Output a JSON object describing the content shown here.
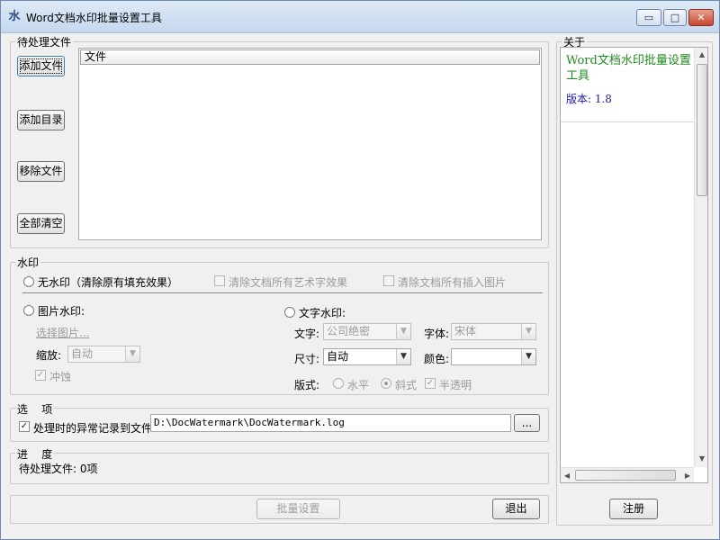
{
  "window": {
    "title": "Word文档水印批量设置工具",
    "controls": {
      "minimize": "▭",
      "maximize": "□",
      "close": "✕"
    }
  },
  "files": {
    "group_title": "待处理文件",
    "buttons": {
      "add_file": "添加文件",
      "add_dir": "添加目录",
      "remove_file": "移除文件",
      "clear_all": "全部清空"
    },
    "list": {
      "column_header": "文件",
      "items": []
    }
  },
  "watermark": {
    "group_title": "水印",
    "no_watermark_label": "无水印（清除原有填充效果）",
    "clear_wordart_label": "清除文档所有艺术字效果",
    "clear_images_label": "清除文档所有插入图片",
    "image": {
      "label": "图片水印:",
      "choose_link": "选择图片...",
      "scale_label": "缩放:",
      "scale_value": "自动",
      "washout_label": "冲蚀",
      "washout_checked": true
    },
    "text": {
      "label": "文字水印:",
      "text_label": "文字:",
      "text_value": "公司绝密",
      "font_label": "字体:",
      "font_value": "宋体",
      "size_label": "尺寸:",
      "size_value": "自动",
      "color_label": "颜色:",
      "color_value": "",
      "layout_label": "版式:",
      "horizontal_label": "水平",
      "diagonal_label": "斜式",
      "semitransparent_label": "半透明",
      "layout_selected": "diagonal",
      "semitransparent_checked": true
    }
  },
  "options": {
    "group_title": "选    项",
    "log_label": "处理时的异常记录到文件:",
    "log_checked": true,
    "log_path": "D:\\DocWatermark\\DocWatermark.log",
    "browse_label": "..."
  },
  "progress": {
    "group_title": "进    度",
    "pending_text": "待处理文件: 0项"
  },
  "bottom": {
    "batch_label": "批量设置",
    "exit_label": "退出"
  },
  "about": {
    "group_title": "关于",
    "app_name": "Word文档水印批量设置工具",
    "version_text": "版本: 1.8",
    "register_label": "注册"
  },
  "icons": {
    "app": "word-watermark-app-icon",
    "check": "✓",
    "dropdown": "▼",
    "scroll_up": "▲",
    "scroll_down": "▼",
    "scroll_left": "◀",
    "scroll_right": "▶"
  }
}
